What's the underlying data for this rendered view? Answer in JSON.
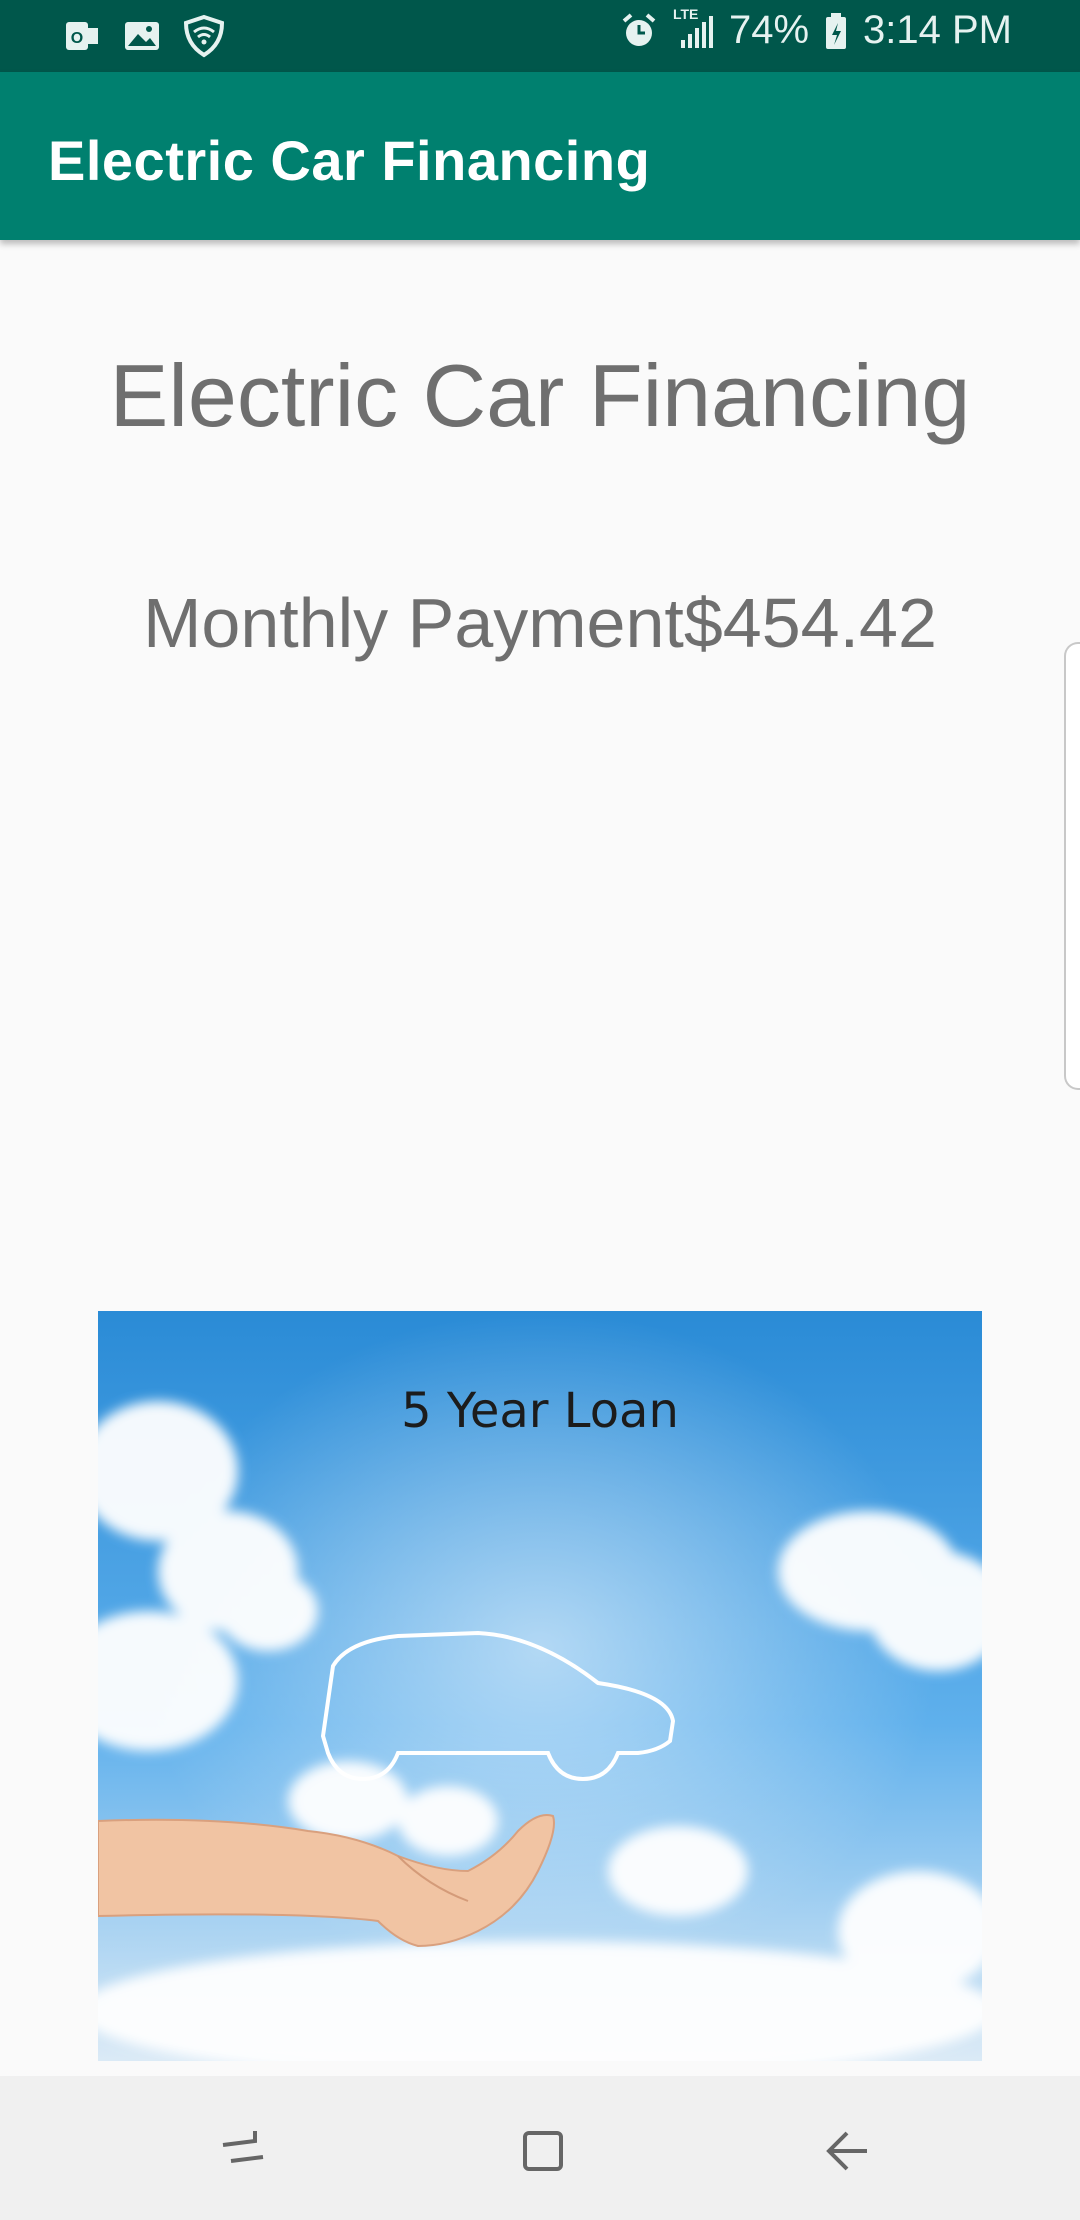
{
  "status_bar": {
    "icons_left": [
      "outlook-icon",
      "gallery-icon",
      "shield-wifi-icon"
    ],
    "icons_right": [
      "alarm-icon",
      "lte-signal-icon",
      "battery-icon"
    ],
    "network_label": "LTE",
    "battery_percent": "74%",
    "time": "3:14 PM"
  },
  "app_bar": {
    "title": "Electric Car Financing"
  },
  "main": {
    "heading": "Electric Car Financing",
    "payment_label": "Monthly Payment$454.42",
    "image": {
      "caption": "5 Year Loan",
      "description_icon": "car-outline-hand-icon"
    }
  },
  "nav_bar": {
    "buttons": [
      "recent-apps-icon",
      "home-icon",
      "back-icon"
    ]
  },
  "colors": {
    "status_bar": "#00574b",
    "app_bar": "#00806f",
    "background": "#fafafa",
    "text": "#6f6f6f",
    "sky": "#2f8fd8"
  }
}
